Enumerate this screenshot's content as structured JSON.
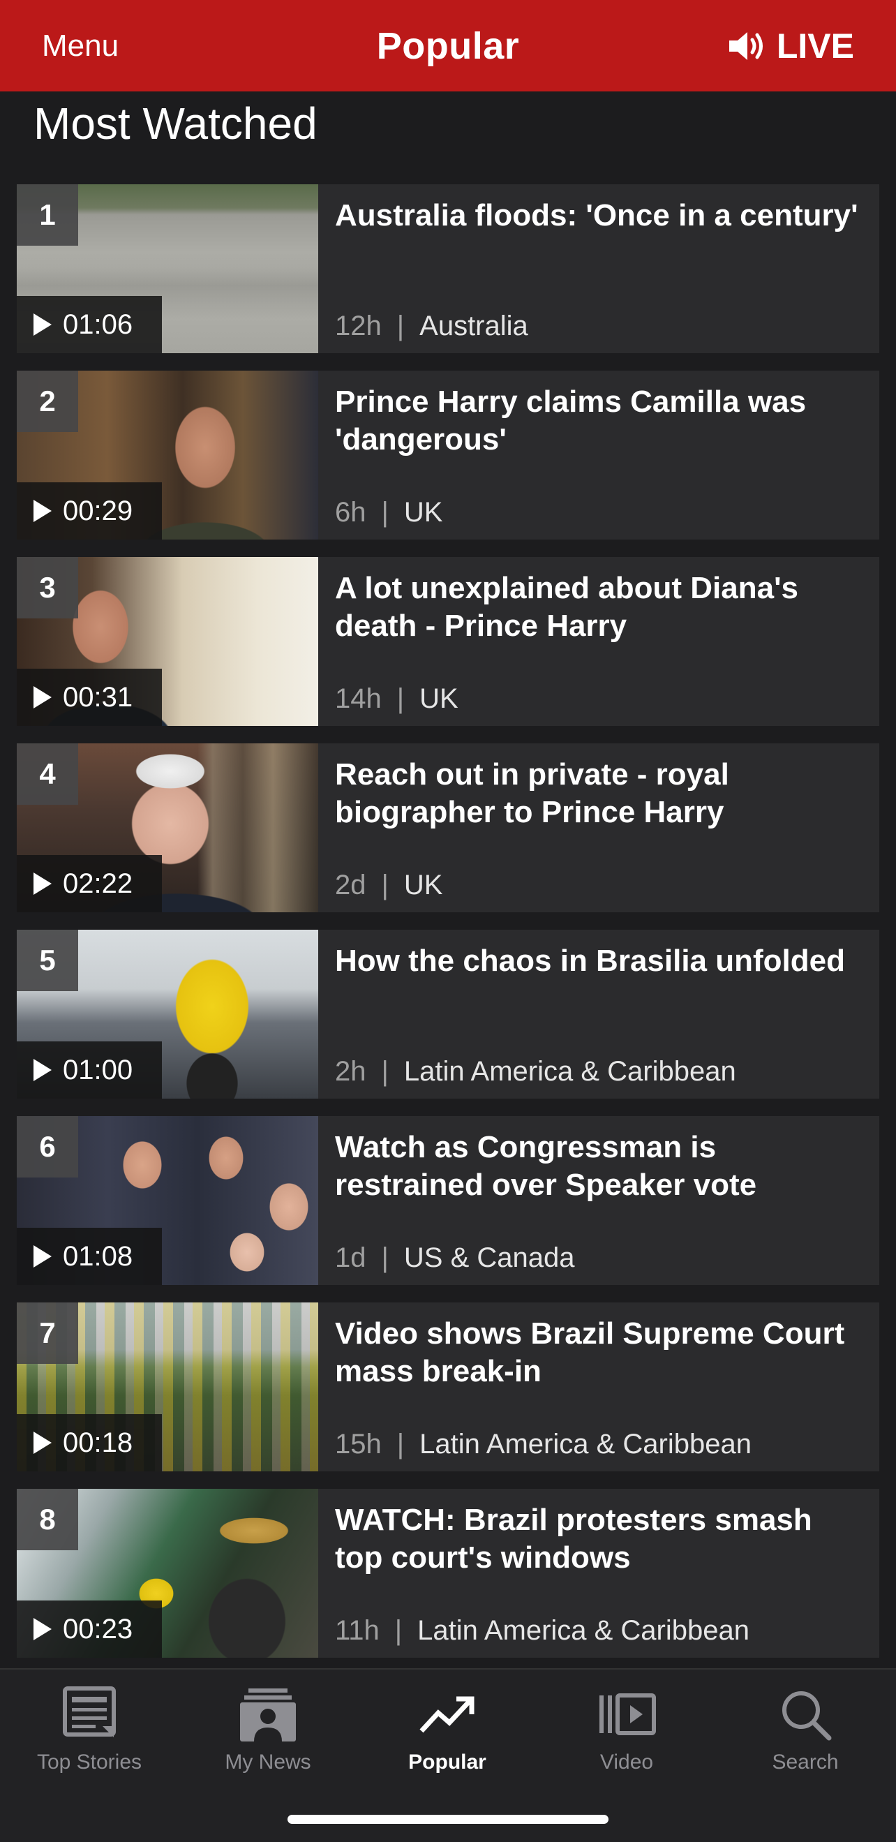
{
  "header": {
    "menu_label": "Menu",
    "title": "Popular",
    "live_label": "LIVE",
    "accent_color": "#bb1919"
  },
  "section": {
    "title": "Most Watched"
  },
  "videos": [
    {
      "rank": "1",
      "duration": "01:06",
      "headline": "Australia floods: 'Once in a century'",
      "time": "12h",
      "category": "Australia"
    },
    {
      "rank": "2",
      "duration": "00:29",
      "headline": "Prince Harry claims Camilla was 'dangerous'",
      "time": "6h",
      "category": "UK"
    },
    {
      "rank": "3",
      "duration": "00:31",
      "headline": "A lot unexplained about Diana's death - Prince Harry",
      "time": "14h",
      "category": "UK"
    },
    {
      "rank": "4",
      "duration": "02:22",
      "headline": "Reach out in private - royal biographer to Prince Harry",
      "time": "2d",
      "category": "UK"
    },
    {
      "rank": "5",
      "duration": "01:00",
      "headline": "How the chaos in Brasilia unfolded",
      "time": "2h",
      "category": "Latin America & Caribbean"
    },
    {
      "rank": "6",
      "duration": "01:08",
      "headline": "Watch as Congressman is restrained over Speaker vote",
      "time": "1d",
      "category": "US & Canada"
    },
    {
      "rank": "7",
      "duration": "00:18",
      "headline": "Video shows Brazil Supreme Court mass break-in",
      "time": "15h",
      "category": "Latin America & Caribbean"
    },
    {
      "rank": "8",
      "duration": "00:23",
      "headline": "WATCH: Brazil protesters smash top court's windows",
      "time": "11h",
      "category": "Latin America & Caribbean"
    }
  ],
  "tabs": [
    {
      "label": "Top Stories",
      "icon": "newspaper-icon"
    },
    {
      "label": "My News",
      "icon": "my-news-icon"
    },
    {
      "label": "Popular",
      "icon": "trending-icon",
      "active": true
    },
    {
      "label": "Video",
      "icon": "video-icon"
    },
    {
      "label": "Search",
      "icon": "search-icon"
    }
  ]
}
